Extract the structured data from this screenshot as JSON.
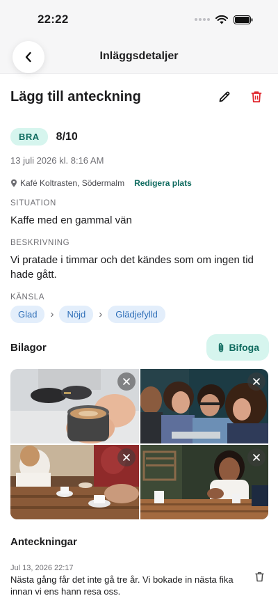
{
  "status_bar": {
    "time": "22:22"
  },
  "nav": {
    "title": "Inläggsdetaljer"
  },
  "entry": {
    "title": "Lägg till anteckning",
    "rating_label": "BRA",
    "rating_score": "8/10",
    "timestamp": "13 juli 2026 kl. 8:16 AM",
    "location": "Kafé Koltrasten, Södermalm",
    "edit_location": "Redigera plats"
  },
  "situation": {
    "label": "SITUATION",
    "text": "Kaffe med en gammal vän"
  },
  "description": {
    "label": "BESKRIVNING",
    "text": "Vi pratade i timmar och det kändes som om ingen tid hade gått."
  },
  "emotion": {
    "label": "KÄNSLA",
    "chain": [
      "Glad",
      "Nöjd",
      "Glädjefylld"
    ],
    "separator": "›"
  },
  "attachments": {
    "title": "Bilagor",
    "add_label": "Bifoga",
    "photos": [
      {
        "name": "coffee-cup-photo"
      },
      {
        "name": "friends-laughing-photo"
      },
      {
        "name": "cafe-table-photo"
      },
      {
        "name": "outdoor-cafe-photo"
      }
    ]
  },
  "notes": {
    "title": "Anteckningar",
    "items": [
      {
        "date": "Jul 13, 2026 22:17",
        "text": "Nästa gång får det inte gå tre år. Vi bokade in nästa fika innan vi ens hann resa oss."
      }
    ]
  },
  "colors": {
    "accent": "#0f6b5f",
    "accent_bg": "#d6f5ee",
    "chip_bg": "#e3eefb",
    "chip_text": "#2f6fb8",
    "delete": "#e0242b"
  },
  "icons": [
    "back-chevron-icon",
    "pencil-icon",
    "trash-icon",
    "location-pin-icon",
    "paperclip-icon",
    "close-icon",
    "wifi-icon",
    "battery-icon"
  ]
}
